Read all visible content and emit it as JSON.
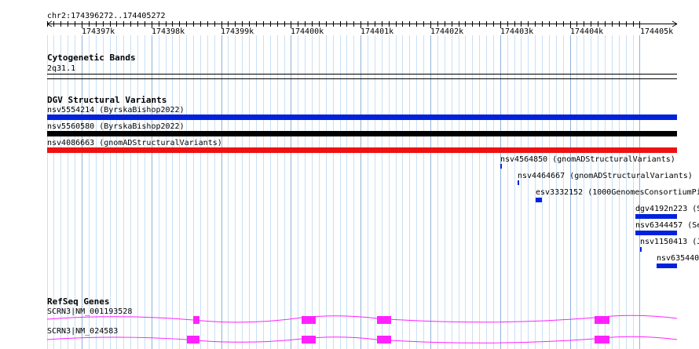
{
  "ruler": {
    "location": "chr2:174396272..174405272",
    "ticks": [
      "174397k",
      "174398k",
      "174399k",
      "174400k",
      "174401k",
      "174402k",
      "174403k",
      "174404k",
      "174405k"
    ]
  },
  "cytoband": {
    "title": "Cytogenetic Bands",
    "band": "2q31.1"
  },
  "dgv": {
    "title": "DGV Structural Variants",
    "features": [
      {
        "label": "nsv5554214 (ByrskaBishop2022)",
        "color": "#0022dd"
      },
      {
        "label": "nsv5560580 (ByrskaBishop2022)",
        "color": "#000000"
      },
      {
        "label": "nsv4086663 (gnomADStructuralVariants)",
        "color": "#ee1111"
      },
      {
        "label": "nsv4564850 (gnomADStructuralVariants)",
        "color": "#0022dd"
      },
      {
        "label": "nsv4464667 (gnomADStructuralVariants)",
        "color": "#0022dd"
      },
      {
        "label": "esv3332152 (1000GenomesConsortiumPi",
        "color": "#0022dd"
      },
      {
        "label": "dgv4192n223 (S",
        "color": "#0022dd"
      },
      {
        "label": "nsv6344457 (Se",
        "color": "#0022dd"
      },
      {
        "label": "nsv1150413 (J",
        "color": "#0022dd"
      },
      {
        "label": "nsv635440",
        "color": "#0022dd"
      }
    ]
  },
  "refseq": {
    "title": "RefSeq Genes",
    "color": "#ff22ff",
    "transcripts": [
      {
        "label": "SCRN3|NM_001193528"
      },
      {
        "label": "SCRN3|NM_024583"
      }
    ]
  }
}
